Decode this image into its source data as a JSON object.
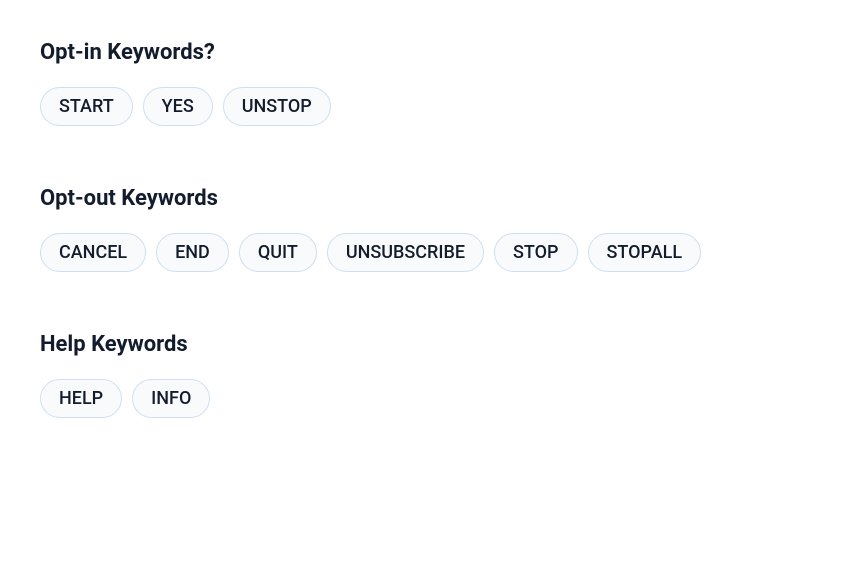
{
  "sections": {
    "optin": {
      "title": "Opt-in Keywords?",
      "items": [
        "START",
        "YES",
        "UNSTOP"
      ]
    },
    "optout": {
      "title": "Opt-out Keywords",
      "items": [
        "CANCEL",
        "END",
        "QUIT",
        "UNSUBSCRIBE",
        "STOP",
        "STOPALL"
      ]
    },
    "help": {
      "title": "Help Keywords",
      "items": [
        "HELP",
        "INFO"
      ]
    }
  }
}
